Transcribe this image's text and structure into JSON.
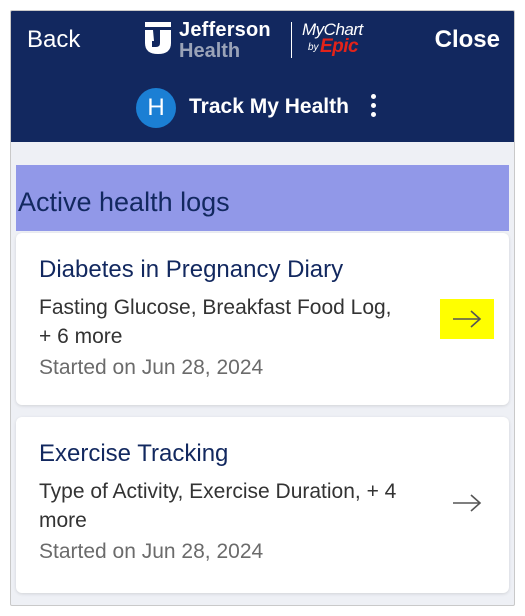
{
  "header": {
    "back_label": "Back",
    "close_label": "Close",
    "brand": {
      "name_line1": "Jefferson",
      "name_line2": "Health",
      "mychart": "MyChart",
      "by": "by",
      "epic": "Epic"
    },
    "avatar_initial": "H",
    "title": "Track My Health"
  },
  "section": {
    "heading": "Active health logs"
  },
  "logs": [
    {
      "title": "Diabetes in Pregnancy Diary",
      "description": "Fasting Glucose, Breakfast Food Log, + 6 more",
      "started": "Started on Jun 28, 2024",
      "highlighted": true
    },
    {
      "title": "Exercise Tracking",
      "description": "Type of Activity, Exercise Duration, + 4 more",
      "started": "Started on Jun 28, 2024",
      "highlighted": false
    }
  ],
  "colors": {
    "header_bg": "#12285f",
    "section_heading_bg": "#9198e8",
    "avatar_bg": "#1b7fd4",
    "epic_red": "#e2231a",
    "highlight": "#ffff00"
  },
  "icons": [
    "jefferson-logo-icon",
    "more-vertical-icon",
    "arrow-right-icon"
  ]
}
